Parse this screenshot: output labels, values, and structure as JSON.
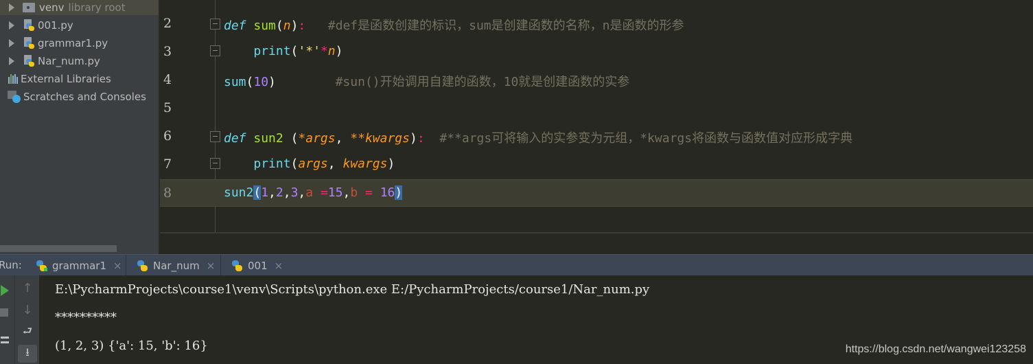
{
  "project_tree": {
    "items": [
      {
        "label": "venv",
        "suffix": "library root",
        "icon": "folder-icon",
        "expandable": true
      },
      {
        "label": "001.py",
        "icon": "python-file-icon",
        "expandable": true
      },
      {
        "label": "grammar1.py",
        "icon": "python-file-icon",
        "expandable": true
      },
      {
        "label": "Nar_num.py",
        "icon": "python-file-icon",
        "expandable": true
      },
      {
        "label": "External Libraries",
        "icon": "library-icon",
        "expandable": false
      },
      {
        "label": "Scratches and Consoles",
        "icon": "scratches-icon",
        "expandable": false
      }
    ]
  },
  "editor": {
    "lines": [
      {
        "number": "2"
      },
      {
        "number": "3"
      },
      {
        "number": "4"
      },
      {
        "number": "5"
      },
      {
        "number": "6"
      },
      {
        "number": "7"
      },
      {
        "number": "8"
      }
    ],
    "tokens": {
      "l2": {
        "def": "def",
        "name": "sum",
        "open": "(",
        "param": "n",
        "close": ")",
        "colon": ":",
        "comment": "#def是函数创建的标识，sum是创建函数的名称，n是函数的形参"
      },
      "l3": {
        "call": "print",
        "open": "(",
        "str": "'*'",
        "op": "*",
        "param": "n",
        "close": ")"
      },
      "l4": {
        "call": "sum",
        "open": "(",
        "num": "10",
        "close": ")",
        "comment": "#sun()开始调用自建的函数，10就是创建函数的实参"
      },
      "l6": {
        "def": "def",
        "name": "sun2",
        "sp": " ",
        "open": "(",
        "p1": "*args",
        "comma": ", ",
        "p2": "**kwargs",
        "close": ")",
        "colon": ":",
        "comment": "#**args可将输入的实参变为元组，*kwargs将函数与函数值对应形成字典"
      },
      "l7": {
        "call": "print",
        "open": "(",
        "p1": "args",
        "comma": ", ",
        "p2": "kwargs",
        "close": ")"
      },
      "l8": {
        "call": "sun2",
        "open": "(",
        "n1": "1",
        "c1": ",",
        "n2": "2",
        "c2": ",",
        "n3": "3",
        "c3": ",",
        "kw1": "a",
        "eq1": " =",
        "n4": "15",
        "c4": ",",
        "kw2": "b",
        "eq2": " = ",
        "n5": "16",
        "close": ")"
      }
    }
  },
  "run_panel": {
    "label": "Run:",
    "tabs": [
      {
        "label": "grammar1",
        "close": "×",
        "running": true
      },
      {
        "label": "Nar_num",
        "close": "×",
        "active": true
      },
      {
        "label": "001",
        "close": "×"
      }
    ],
    "toolbar": {
      "rerun": "run-icon",
      "stop": "stop-icon",
      "layout": "layout-icon",
      "up": "↑",
      "down": "↓",
      "soft_wrap": "⮐",
      "scroll_end": "⭳"
    },
    "output": [
      "E:\\PycharmProjects\\course1\\venv\\Scripts\\python.exe E:/PycharmProjects/course1/Nar_num.py",
      "**********",
      "(1, 2, 3) {'a': 15, 'b': 16}"
    ]
  },
  "watermark": "https://blog.csdn.net/wangwei123258"
}
